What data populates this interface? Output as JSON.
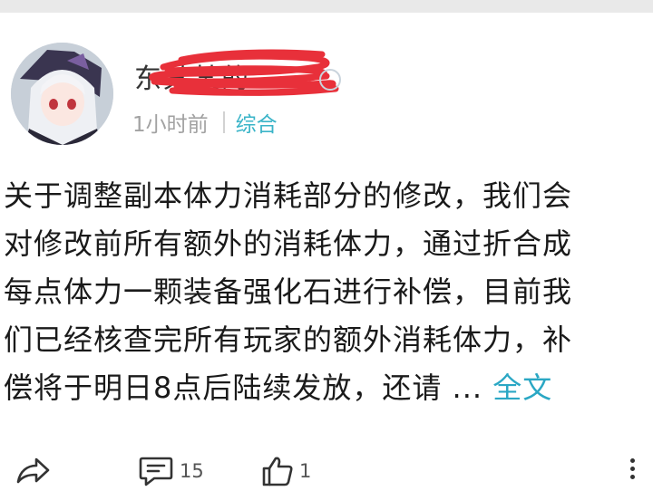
{
  "post": {
    "author_name": "东某某的",
    "time": "1小时前",
    "category": "综合",
    "content_lines": [
      "关于调整副本体力消耗部分的修改，我们会",
      "对修改前所有额外的消耗体力，通过折合成",
      "每点体力一颗装备强化石进行补偿，目前我",
      "们已经核查完所有玩家的额外消耗体力，补",
      "偿将于明日8点后陆续发放，还请 ..."
    ],
    "more_label": "全文"
  },
  "actions": {
    "share_icon": "share-icon",
    "comment_icon": "comment-icon",
    "comment_count": "15",
    "like_icon": "thumbs-up-icon",
    "like_count": "1",
    "menu_icon": "more-vertical-icon"
  },
  "colors": {
    "accent": "#3ab4c8",
    "redaction": "#e8303a",
    "meta_gray": "#a2a2a2"
  }
}
